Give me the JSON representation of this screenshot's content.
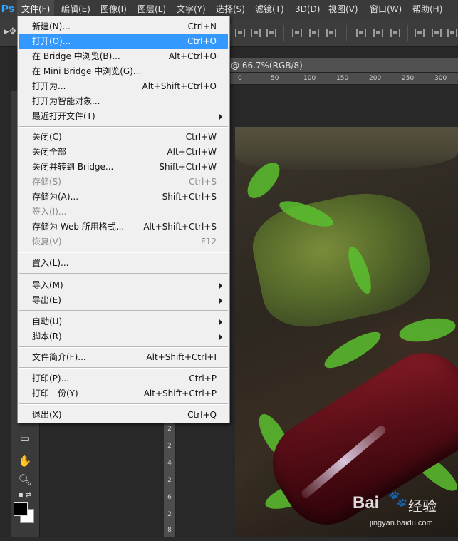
{
  "menubar": {
    "logo": "Ps",
    "items": [
      {
        "label": "文件(F)",
        "active": true
      },
      {
        "label": "编辑(E)"
      },
      {
        "label": "图像(I)"
      },
      {
        "label": "图层(L)"
      },
      {
        "label": "文字(Y)"
      },
      {
        "label": "选择(S)"
      },
      {
        "label": "滤镜(T)"
      },
      {
        "label": "3D(D)"
      },
      {
        "label": "视图(V)"
      },
      {
        "label": "窗口(W)"
      },
      {
        "label": "帮助(H)"
      }
    ]
  },
  "document": {
    "tab_title": "@ 66.7%(RGB/8)",
    "ruler_h": [
      "0",
      "50",
      "100",
      "150",
      "200",
      "250",
      "300"
    ],
    "ruler_v": [
      "2",
      "2",
      "4",
      "2",
      "6",
      "2",
      "8"
    ]
  },
  "watermark": {
    "logo": "Bai",
    "logo_tail": "经验",
    "url": "jingyan.baidu.com"
  },
  "file_menu": {
    "items": [
      {
        "label": "新建(N)...",
        "shortcut": "Ctrl+N"
      },
      {
        "label": "打开(O)...",
        "shortcut": "Ctrl+O",
        "highlighted": true
      },
      {
        "label": "在 Bridge 中浏览(B)...",
        "shortcut": "Alt+Ctrl+O"
      },
      {
        "label": "在 Mini Bridge 中浏览(G)...",
        "shortcut": ""
      },
      {
        "label": "打开为...",
        "shortcut": "Alt+Shift+Ctrl+O"
      },
      {
        "label": "打开为智能对象...",
        "shortcut": ""
      },
      {
        "label": "最近打开文件(T)",
        "shortcut": "",
        "submenu": true
      },
      {
        "label": "关闭(C)",
        "shortcut": "Ctrl+W"
      },
      {
        "label": "关闭全部",
        "shortcut": "Alt+Ctrl+W"
      },
      {
        "label": "关闭并转到 Bridge...",
        "shortcut": "Shift+Ctrl+W"
      },
      {
        "label": "存储(S)",
        "shortcut": "Ctrl+S",
        "disabled": true
      },
      {
        "label": "存储为(A)...",
        "shortcut": "Shift+Ctrl+S"
      },
      {
        "label": "签入(I)...",
        "shortcut": "",
        "disabled": true
      },
      {
        "label": "存储为 Web 所用格式...",
        "shortcut": "Alt+Shift+Ctrl+S"
      },
      {
        "label": "恢复(V)",
        "shortcut": "F12",
        "disabled": true
      },
      {
        "label": "置入(L)...",
        "shortcut": ""
      },
      {
        "label": "导入(M)",
        "shortcut": "",
        "submenu": true
      },
      {
        "label": "导出(E)",
        "shortcut": "",
        "submenu": true
      },
      {
        "label": "自动(U)",
        "shortcut": "",
        "submenu": true
      },
      {
        "label": "脚本(R)",
        "shortcut": "",
        "submenu": true
      },
      {
        "label": "文件简介(F)...",
        "shortcut": "Alt+Shift+Ctrl+I"
      },
      {
        "label": "打印(P)...",
        "shortcut": "Ctrl+P"
      },
      {
        "label": "打印一份(Y)",
        "shortcut": "Alt+Shift+Ctrl+P"
      },
      {
        "label": "退出(X)",
        "shortcut": "Ctrl+Q"
      }
    ]
  }
}
